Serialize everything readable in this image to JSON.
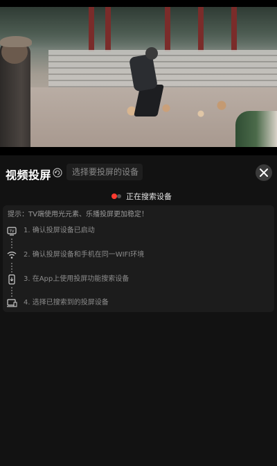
{
  "header": {
    "title": "视频投屏",
    "device_select_placeholder": "选择要投屏的设备",
    "close_icon": "close-icon",
    "refresh_icon": "refresh-icon"
  },
  "status": {
    "text": "正在搜索设备",
    "dot_colors": [
      "#ff3b30",
      "#555555"
    ]
  },
  "tips": {
    "hint": "提示：TV端使用光元素、乐播投屏更加稳定！",
    "steps": [
      {
        "icon": "tv-icon",
        "label": "1. 确认投屏设备已启动"
      },
      {
        "icon": "wifi-icon",
        "label": "2. 确认投屏设备和手机在同一WIFI环境"
      },
      {
        "icon": "phone-cast-icon",
        "label": "3. 在App上使用投屏功能搜索设备"
      },
      {
        "icon": "cast-device-icon",
        "label": "4. 选择已搜索到的投屏设备"
      }
    ]
  },
  "colors": {
    "background": "#121212",
    "panel": "#1c1c1c",
    "accent_red": "#ff3b30"
  }
}
